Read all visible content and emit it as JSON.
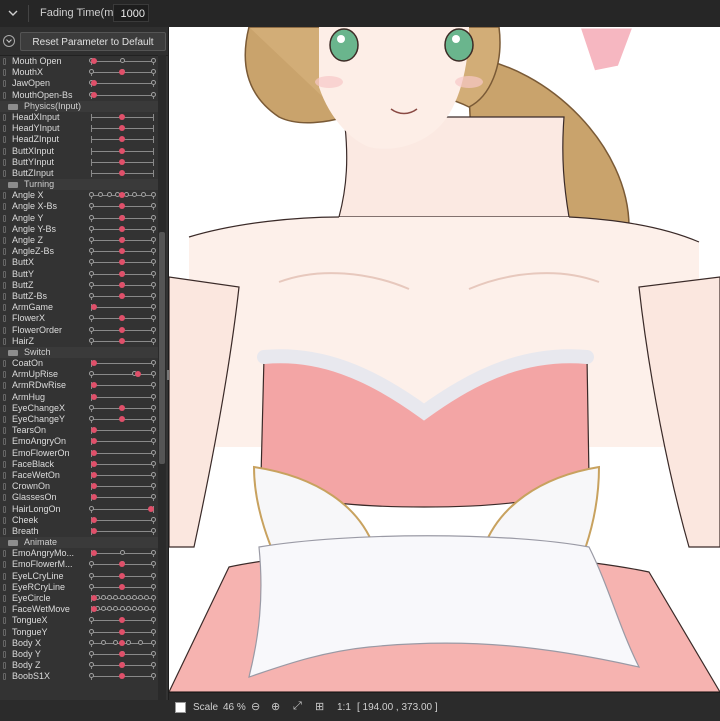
{
  "topbar": {
    "fading_label": "Fading Time(ms):",
    "fading_value": "1000"
  },
  "panel": {
    "reset_label": "Reset Parameter to Default",
    "rows": [
      {
        "t": "p",
        "name": "Mouth Open",
        "knobs": [
          0,
          0.5,
          1
        ],
        "dot": 0.05
      },
      {
        "t": "p",
        "name": "MouthX",
        "knobs": [
          0,
          0.5,
          1
        ],
        "dot": 0.5
      },
      {
        "t": "p",
        "name": "JawOpen",
        "knobs": [
          0,
          1
        ],
        "dot": 0.05
      },
      {
        "t": "p",
        "name": "MouthOpen-Bs",
        "knobs": [
          0,
          1
        ],
        "dot": 0.05
      },
      {
        "t": "g",
        "name": "Physics(Input)"
      },
      {
        "t": "p",
        "name": "HeadXInput",
        "knobs": [],
        "dot": 0.5
      },
      {
        "t": "p",
        "name": "HeadYInput",
        "knobs": [],
        "dot": 0.5
      },
      {
        "t": "p",
        "name": "HeadZInput",
        "knobs": [],
        "dot": 0.5
      },
      {
        "t": "p",
        "name": "ButtXInput",
        "knobs": [],
        "dot": 0.5
      },
      {
        "t": "p",
        "name": "ButtYInput",
        "knobs": [],
        "dot": 0.5
      },
      {
        "t": "p",
        "name": "ButtZInput",
        "knobs": [],
        "dot": 0.5
      },
      {
        "t": "g",
        "name": "Turning"
      },
      {
        "t": "p",
        "name": "Angle X",
        "knobs": [
          0,
          0.15,
          0.3,
          0.42,
          0.58,
          0.7,
          0.85,
          1
        ],
        "dot": 0.5
      },
      {
        "t": "p",
        "name": "Angle X-Bs",
        "knobs": [
          0,
          1
        ],
        "dot": 0.5
      },
      {
        "t": "p",
        "name": "Angle Y",
        "knobs": [
          0,
          0.5,
          1
        ],
        "dot": 0.5
      },
      {
        "t": "p",
        "name": "Angle Y-Bs",
        "knobs": [
          0,
          1
        ],
        "dot": 0.5
      },
      {
        "t": "p",
        "name": "Angle Z",
        "knobs": [
          0,
          0.5,
          1
        ],
        "dot": 0.5
      },
      {
        "t": "p",
        "name": "AngleZ-Bs",
        "knobs": [
          0,
          1
        ],
        "dot": 0.5
      },
      {
        "t": "p",
        "name": "ButtX",
        "knobs": [
          0,
          0.5,
          1
        ],
        "dot": 0.5
      },
      {
        "t": "p",
        "name": "ButtY",
        "knobs": [
          0,
          0.5,
          1
        ],
        "dot": 0.5
      },
      {
        "t": "p",
        "name": "ButtZ",
        "knobs": [
          0,
          0.5,
          1
        ],
        "dot": 0.5
      },
      {
        "t": "p",
        "name": "ButtZ-Bs",
        "knobs": [
          0,
          1
        ],
        "dot": 0.5
      },
      {
        "t": "p",
        "name": "ArmGame",
        "knobs": [
          1
        ],
        "dot": 0.05
      },
      {
        "t": "p",
        "name": "FlowerX",
        "knobs": [
          0,
          1
        ],
        "dot": 0.5
      },
      {
        "t": "p",
        "name": "FlowerOrder",
        "knobs": [
          0,
          1
        ],
        "dot": 0.5
      },
      {
        "t": "p",
        "name": "HairZ",
        "knobs": [
          0,
          1
        ],
        "dot": 0.5
      },
      {
        "t": "g",
        "name": "Switch"
      },
      {
        "t": "p",
        "name": "CoatOn",
        "knobs": [
          1
        ],
        "dot": 0.05
      },
      {
        "t": "p",
        "name": "ArmUpRise",
        "knobs": [
          0,
          0.7,
          1
        ],
        "dot": 0.75
      },
      {
        "t": "p",
        "name": "ArmRDwRise",
        "knobs": [
          1
        ],
        "dot": 0.05
      },
      {
        "t": "p",
        "name": "ArmHug",
        "knobs": [
          1
        ],
        "dot": 0.05
      },
      {
        "t": "p",
        "name": "EyeChangeX",
        "knobs": [
          0,
          1
        ],
        "dot": 0.5
      },
      {
        "t": "p",
        "name": "EyeChangeY",
        "knobs": [
          0,
          1
        ],
        "dot": 0.5
      },
      {
        "t": "p",
        "name": "TearsOn",
        "knobs": [
          1
        ],
        "dot": 0.05
      },
      {
        "t": "p",
        "name": "EmoAngryOn",
        "knobs": [
          1
        ],
        "dot": 0.05
      },
      {
        "t": "p",
        "name": "EmoFlowerOn",
        "knobs": [
          1
        ],
        "dot": 0.05
      },
      {
        "t": "p",
        "name": "FaceBlack",
        "knobs": [
          1
        ],
        "dot": 0.05
      },
      {
        "t": "p",
        "name": "FaceWetOn",
        "knobs": [
          1
        ],
        "dot": 0.05
      },
      {
        "t": "p",
        "name": "CrownOn",
        "knobs": [
          1
        ],
        "dot": 0.05
      },
      {
        "t": "p",
        "name": "GlassesOn",
        "knobs": [
          1
        ],
        "dot": 0.05
      },
      {
        "t": "p",
        "name": "HairLongOn",
        "knobs": [
          0
        ],
        "dot": 0.97
      },
      {
        "t": "p",
        "name": "Cheek",
        "knobs": [
          1
        ],
        "dot": 0.05
      },
      {
        "t": "p",
        "name": "Breath",
        "knobs": [
          1
        ],
        "dot": 0.05
      },
      {
        "t": "g",
        "name": "Animate"
      },
      {
        "t": "p",
        "name": "EmoAngryMo...",
        "knobs": [
          0.5,
          1
        ],
        "dot": 0.05
      },
      {
        "t": "p",
        "name": "EmoFlowerM...",
        "knobs": [
          0,
          0.5,
          1
        ],
        "dot": 0.5
      },
      {
        "t": "p",
        "name": "EyeLCryLine",
        "knobs": [
          0,
          1
        ],
        "dot": 0.5
      },
      {
        "t": "p",
        "name": "EyeRCryLine",
        "knobs": [
          0,
          1
        ],
        "dot": 0.5
      },
      {
        "t": "p",
        "name": "EyeCircle",
        "knobs": [
          0.1,
          0.2,
          0.3,
          0.4,
          0.5,
          0.6,
          0.7,
          0.8,
          0.9,
          1
        ],
        "dot": 0.05
      },
      {
        "t": "p",
        "name": "FaceWetMove",
        "knobs": [
          0.1,
          0.2,
          0.3,
          0.4,
          0.5,
          0.6,
          0.7,
          0.8,
          0.9,
          1
        ],
        "dot": 0.05
      },
      {
        "t": "p",
        "name": "TongueX",
        "knobs": [
          0,
          1
        ],
        "dot": 0.5
      },
      {
        "t": "p",
        "name": "TongueY",
        "knobs": [
          0,
          1
        ],
        "dot": 0.5
      },
      {
        "t": "p",
        "name": "Body X",
        "knobs": [
          0,
          0.2,
          0.4,
          0.6,
          0.8,
          1
        ],
        "dot": 0.5
      },
      {
        "t": "p",
        "name": "Body Y",
        "knobs": [
          0,
          0.5,
          1
        ],
        "dot": 0.5
      },
      {
        "t": "p",
        "name": "Body Z",
        "knobs": [
          0,
          0.5,
          1
        ],
        "dot": 0.5
      },
      {
        "t": "p",
        "name": "BoobS1X",
        "knobs": [
          0,
          1
        ],
        "dot": 0.5
      }
    ]
  },
  "status": {
    "scale_label": "Scale",
    "scale_value": "46 %",
    "ratio_label": "1:1",
    "coords": "[ 194.00 ,  373.00 ]"
  },
  "colors": {
    "accent": "#e0506a",
    "panel_bg": "#333333",
    "canvas_bg": "#ffffff"
  }
}
